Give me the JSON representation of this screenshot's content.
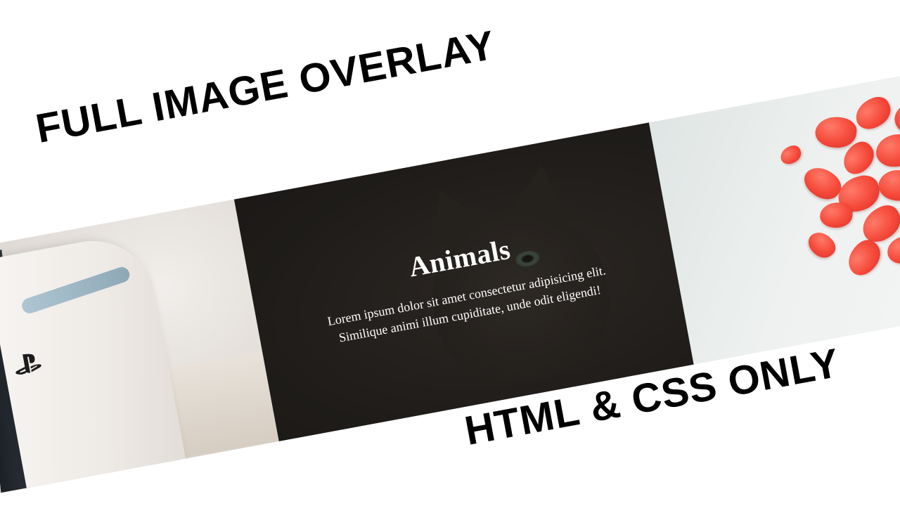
{
  "headlines": {
    "top": "FULL IMAGE OVERLAY",
    "bottom": "HTML & CSS ONLY"
  },
  "overlay_card": {
    "title": "Animals",
    "text": "Lorem ipsum dolor sit amet consectetur adipisicing elit. Similique animi illum cupiditate, unde odit eligendi!"
  },
  "panels": [
    {
      "name": "ps5-console-photo",
      "icon": "playstation-logo-icon"
    },
    {
      "name": "cat-photo-with-overlay"
    },
    {
      "name": "rose-petals-photo"
    }
  ],
  "colors": {
    "headline": "#000000",
    "overlay": "#141211",
    "petal": "#f5493a",
    "background": "#ffffff"
  }
}
